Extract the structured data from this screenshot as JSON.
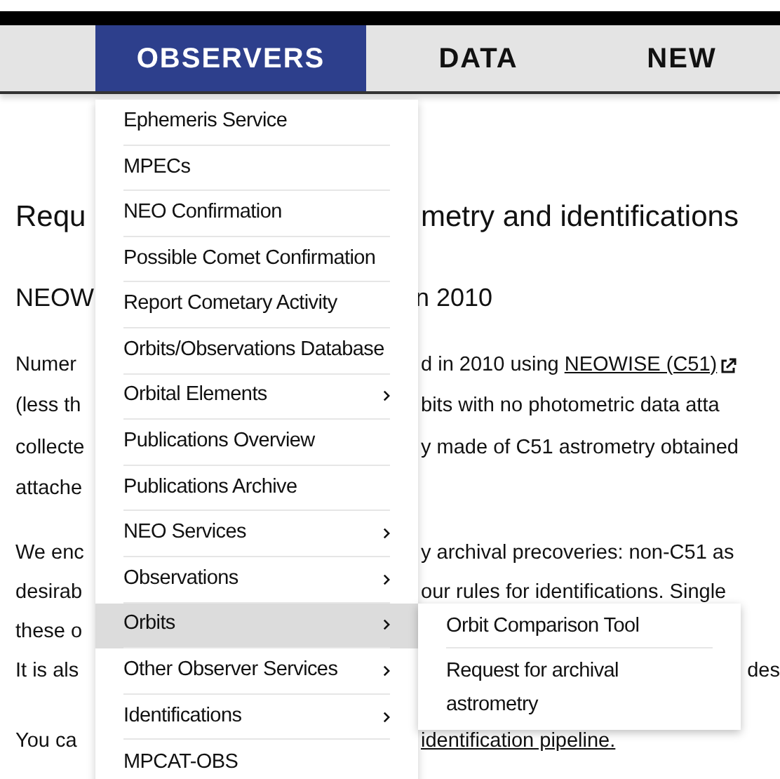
{
  "nav": {
    "tabs": [
      {
        "label": "OBSERVERS",
        "selected": true
      },
      {
        "label": "DATA",
        "selected": false
      },
      {
        "label": "NEW",
        "selected": false
      }
    ]
  },
  "menu": {
    "items": [
      {
        "label": "Ephemeris Service",
        "has_submenu": false,
        "selected": false
      },
      {
        "label": "MPECs",
        "has_submenu": false,
        "selected": false
      },
      {
        "label": "NEO Confirmation",
        "has_submenu": false,
        "selected": false
      },
      {
        "label": "Possible Comet Confirmation",
        "has_submenu": false,
        "selected": false
      },
      {
        "label": "Report Cometary Activity",
        "has_submenu": false,
        "selected": false
      },
      {
        "label": "Orbits/Observations Database",
        "has_submenu": false,
        "selected": false
      },
      {
        "label": "Orbital Elements",
        "has_submenu": true,
        "selected": false
      },
      {
        "label": "Publications Overview",
        "has_submenu": false,
        "selected": false
      },
      {
        "label": "Publications Archive",
        "has_submenu": false,
        "selected": false
      },
      {
        "label": "NEO Services",
        "has_submenu": true,
        "selected": false
      },
      {
        "label": "Observations",
        "has_submenu": true,
        "selected": false
      },
      {
        "label": "Orbits",
        "has_submenu": true,
        "selected": true,
        "children": [
          {
            "label": "Orbit Comparison Tool"
          },
          {
            "label": "Request for archival astrometry"
          }
        ]
      },
      {
        "label": "Other Observer Services",
        "has_submenu": true,
        "selected": false
      },
      {
        "label": "Identifications",
        "has_submenu": true,
        "selected": false
      },
      {
        "label": "MPCAT-OBS",
        "has_submenu": false,
        "selected": false
      }
    ]
  },
  "page": {
    "heading": {
      "left": "Requ",
      "right": "metry and identifications"
    },
    "subheading": {
      "left": "NEOW",
      "right": "n 2010"
    },
    "paragraphs": [
      [
        {
          "left": "Numer",
          "right": "d in 2010 using ",
          "link": "NEOWISE (C51)",
          "external": true
        },
        {
          "left": "(less th",
          "right": "bits with no photometric data atta"
        },
        {
          "left": "collecte",
          "right": "y made of C51 astrometry obtained"
        },
        {
          "left": "attache"
        }
      ],
      [
        {
          "left": "We enc",
          "right": "y archival precoveries: non-C51 as"
        },
        {
          "left": "desirab",
          "right": "our rules for identifications. Single"
        },
        {
          "left": "these o"
        },
        {
          "left": "It is als",
          "far": "des"
        },
        {
          "left": "You ca",
          "link": "identification pipeline."
        }
      ]
    ]
  }
}
